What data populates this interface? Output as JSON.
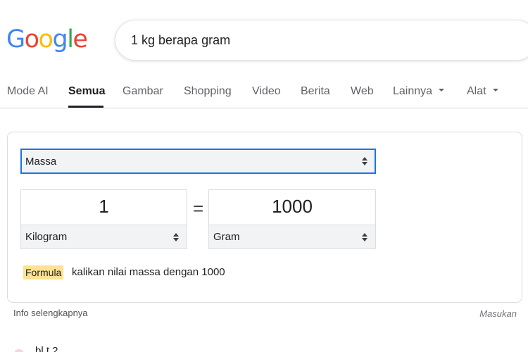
{
  "logo": {
    "letters": [
      "G",
      "o",
      "o",
      "g",
      "l",
      "e"
    ]
  },
  "search": {
    "query": "1 kg berapa gram"
  },
  "tabs": [
    {
      "label": "Mode AI",
      "active": false
    },
    {
      "label": "Semua",
      "active": true
    },
    {
      "label": "Gambar",
      "active": false
    },
    {
      "label": "Shopping",
      "active": false
    },
    {
      "label": "Video",
      "active": false
    },
    {
      "label": "Berita",
      "active": false
    },
    {
      "label": "Web",
      "active": false
    },
    {
      "label": "Lainnya",
      "active": false,
      "dropdown": true
    },
    {
      "label": "Alat",
      "active": false,
      "dropdown": true
    }
  ],
  "converter": {
    "category": "Massa",
    "left_value": "1",
    "left_unit": "Kilogram",
    "equals": "=",
    "right_value": "1000",
    "right_unit": "Gram",
    "formula_label": "Formula",
    "formula_text": "kalikan nilai massa dengan 1000"
  },
  "footer": {
    "info_link": "Info selengkapnya",
    "feedback": "Masukan"
  },
  "next_result": {
    "partial_text": "bl t  2"
  },
  "colors": {
    "accent_blue": "#1a73e8",
    "formula_highlight": "#fde293",
    "active_tab_underline": "#202124"
  }
}
